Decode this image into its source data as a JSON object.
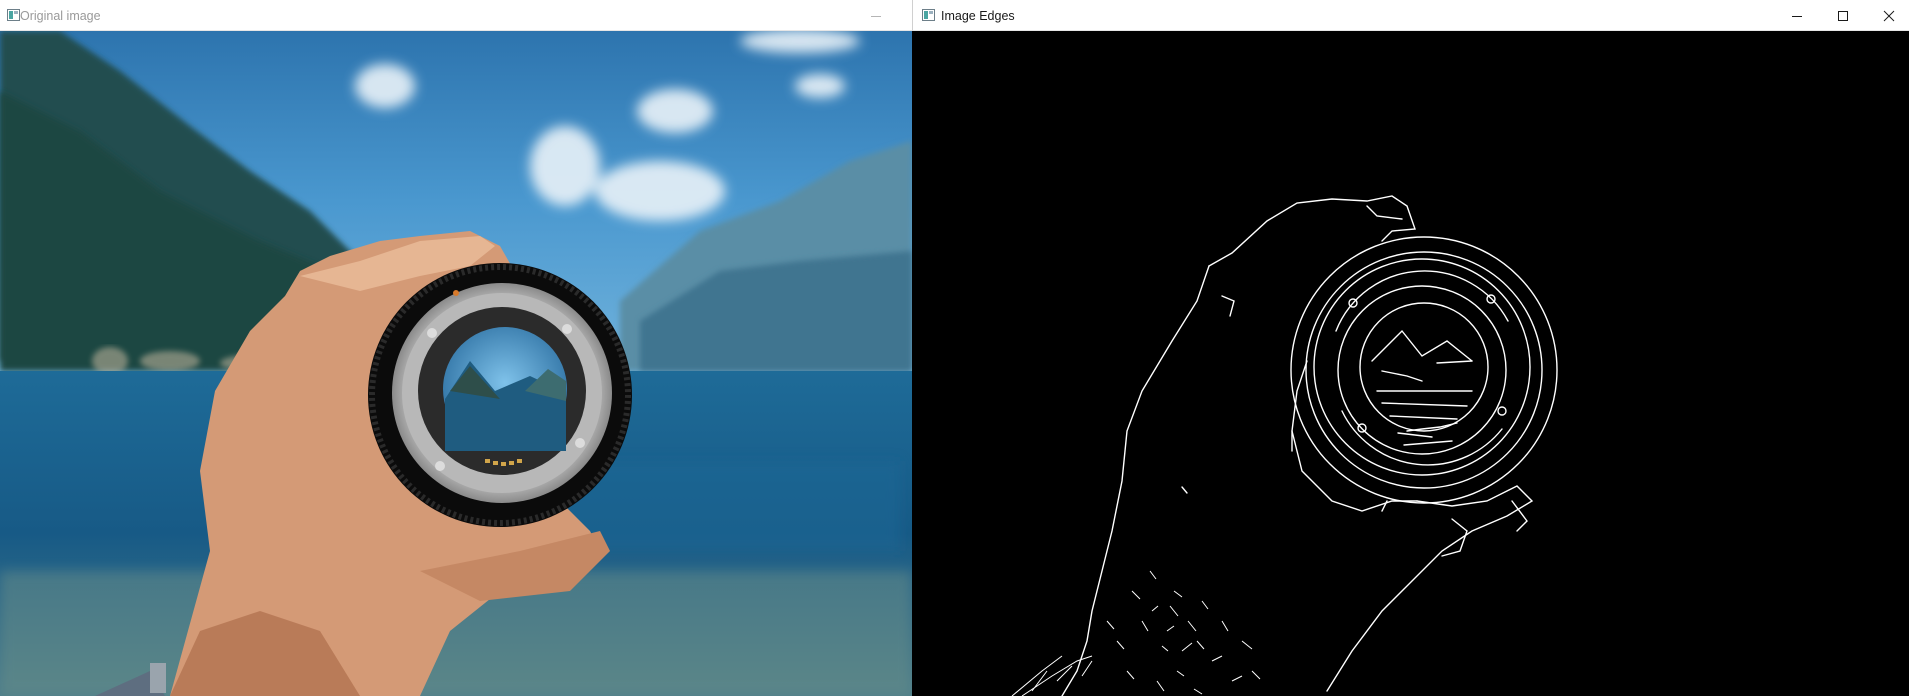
{
  "windows": {
    "original": {
      "title": "Original image",
      "icon": "app-window-icon",
      "controls": [
        "minimize-icon"
      ],
      "state": "inactive"
    },
    "edges": {
      "title": "Image Edges",
      "icon": "app-window-icon",
      "controls": [
        "minimize-icon",
        "maximize-icon",
        "close-icon"
      ],
      "state": "active"
    }
  },
  "colors": {
    "sky_top": "#2f79b6",
    "sky_bottom": "#6fb4de",
    "water": "#175c8c",
    "mountain": "#2a5a5e",
    "skin": "#d9a07c",
    "lens_barrel": "#111111",
    "edge_background": "#000000",
    "edge_lines": "#ffffff"
  }
}
